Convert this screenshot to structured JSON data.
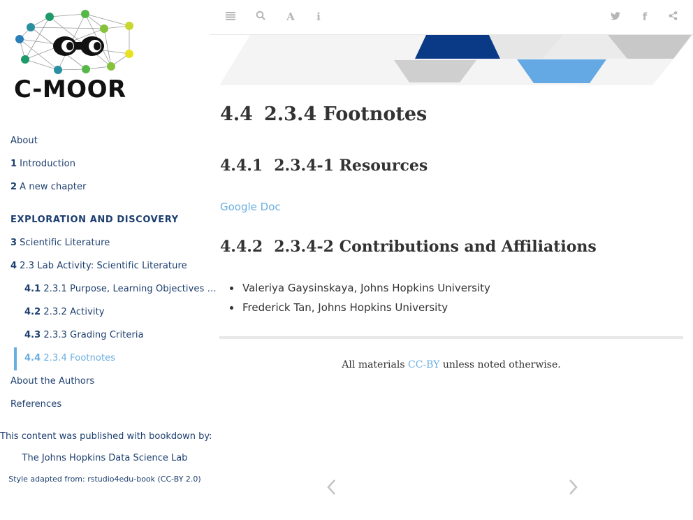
{
  "logo": {
    "text": "C-MOOR"
  },
  "sidebar": {
    "items": [
      {
        "num": "",
        "label": "About"
      },
      {
        "num": "1",
        "label": "Introduction"
      },
      {
        "num": "2",
        "label": "A new chapter"
      }
    ],
    "part_label": "EXPLORATION AND DISCOVERY",
    "chapters": [
      {
        "num": "3",
        "label": "Scientific Literature"
      },
      {
        "num": "4",
        "label": "2.3 Lab Activity: Scientific Literature"
      }
    ],
    "subitems": [
      {
        "num": "4.1",
        "label": "2.3.1 Purpose, Learning Objectives …"
      },
      {
        "num": "4.2",
        "label": "2.3.2 Activity"
      },
      {
        "num": "4.3",
        "label": "2.3.3 Grading Criteria"
      },
      {
        "num": "4.4",
        "label": "2.3.4 Footnotes"
      }
    ],
    "tail_items": [
      {
        "label": "About the Authors"
      },
      {
        "label": "References"
      }
    ],
    "footer": {
      "published": "This content was published with bookdown by:",
      "lab": "The Johns Hopkins Data Science Lab",
      "style": "Style adapted from: rstudio4edu-book (CC-BY 2.0)"
    }
  },
  "toolbar": {
    "icons": [
      "menu-icon",
      "search-icon",
      "font-icon",
      "info-icon",
      "twitter-icon",
      "facebook-icon",
      "share-icon"
    ]
  },
  "main": {
    "h1": {
      "num": "4.4",
      "title": "2.3.4 Footnotes"
    },
    "resources": {
      "num": "4.4.1",
      "title": "2.3.4-1 Resources"
    },
    "link_label": "Google Doc",
    "contributions": {
      "num": "4.4.2",
      "title": "2.3.4-2 Contributions and Affiliations"
    },
    "contributors": [
      "Valeriya Gaysinskaya, Johns Hopkins University",
      "Frederick Tan, Johns Hopkins University"
    ],
    "license": {
      "prefix": "All materials ",
      "link": "CC-BY",
      "suffix": " unless noted otherwise."
    }
  },
  "colors": {
    "nav_text": "#1c3e6e",
    "accent": "#6aaee0",
    "banner_navy": "#0a3a86",
    "banner_blue": "#64a8e4"
  }
}
